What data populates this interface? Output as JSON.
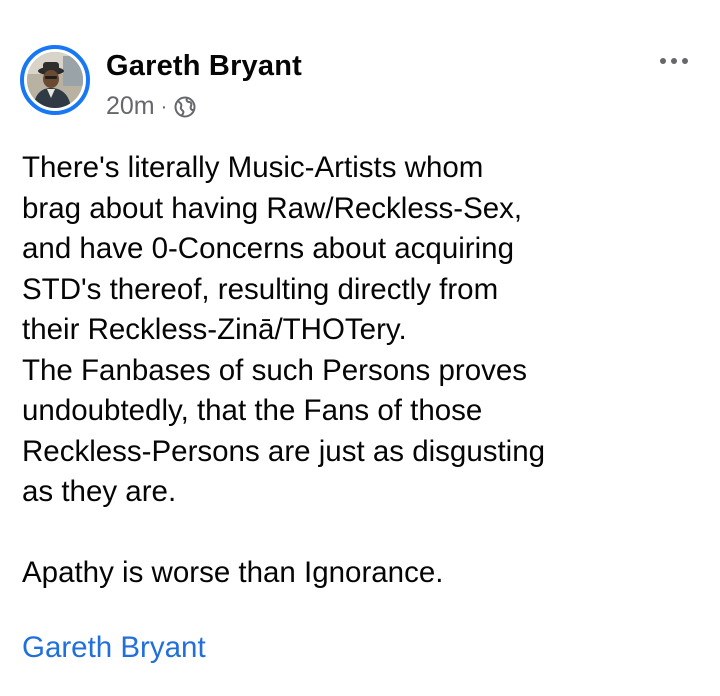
{
  "post": {
    "author": "Gareth Bryant",
    "time": "20m",
    "separator": "·",
    "audience_icon": "globe-icon",
    "more_icon": "more-horizontal-icon",
    "lines": [
      "There's literally Music-Artists whom",
      "brag about having Raw/Reckless-Sex,",
      "and have 0-Concerns about acquiring",
      "STD's thereof, resulting directly from",
      "their Reckless-Zinā/THOTery.",
      "The Fanbases of such Persons proves",
      "undoubtedly, that the Fans of those",
      "Reckless-Persons are just as disgusting",
      "as they are."
    ],
    "closing_line": "Apathy is worse than Ignorance.",
    "signature": "Gareth Bryant"
  },
  "colors": {
    "accent": "#1877f2",
    "link": "#216fdb",
    "secondary_text": "#65676b",
    "primary_text": "#050505"
  }
}
